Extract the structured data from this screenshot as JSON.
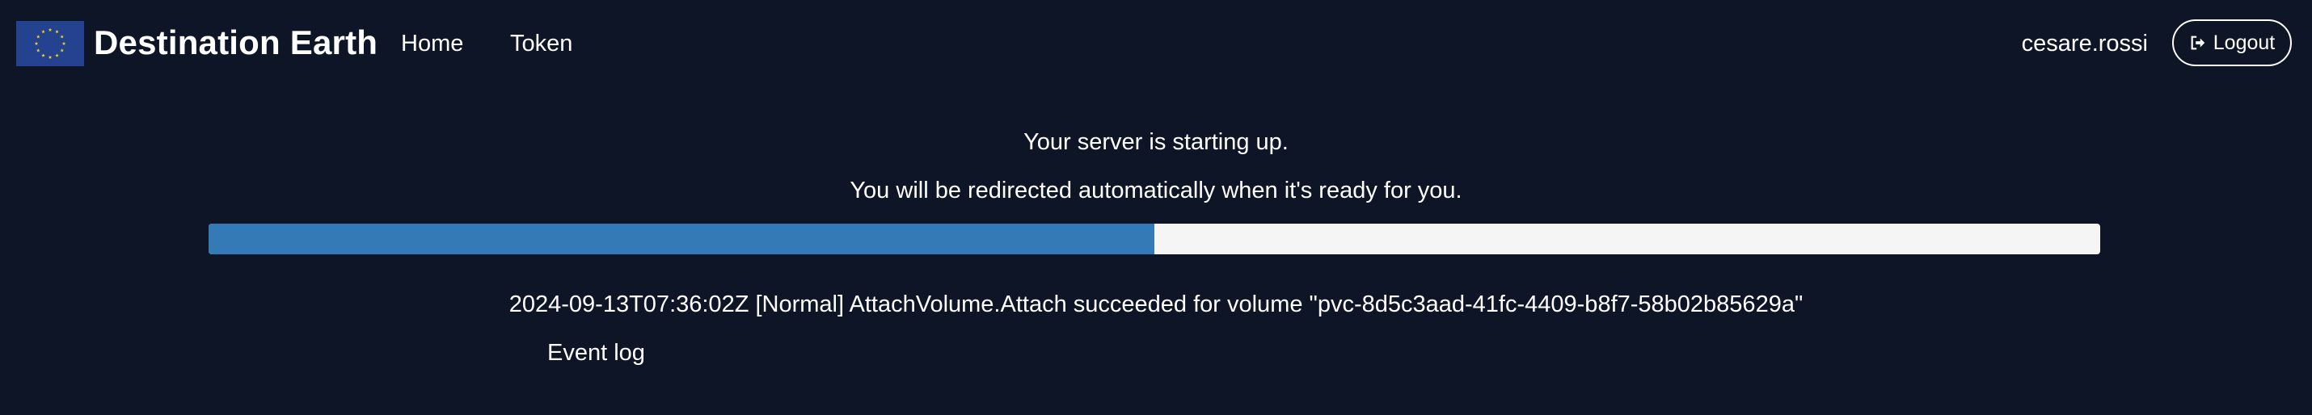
{
  "header": {
    "brand_title": "Destination Earth",
    "logo_icon": "eu-flag-icon",
    "nav": [
      {
        "label": "Home"
      },
      {
        "label": "Token"
      }
    ],
    "username": "cesare.rossi",
    "logout_label": "Logout",
    "logout_icon": "sign-out-icon"
  },
  "main": {
    "status_message": "Your server is starting up.",
    "redirect_message": "You will be redirected automatically when it's ready for you.",
    "progress_percent": 50,
    "progress_color": "#337ab7",
    "latest_event": "2024-09-13T07:36:02Z [Normal] AttachVolume.Attach succeeded for volume \"pvc-8d5c3aad-41fc-4409-b8f7-58b02b85629a\"",
    "event_log_label": "Event log"
  },
  "colors": {
    "background": "#0e1527",
    "flag_blue": "#24428f",
    "flag_stars": "#f4d31d",
    "progress_track": "#f5f5f5"
  }
}
